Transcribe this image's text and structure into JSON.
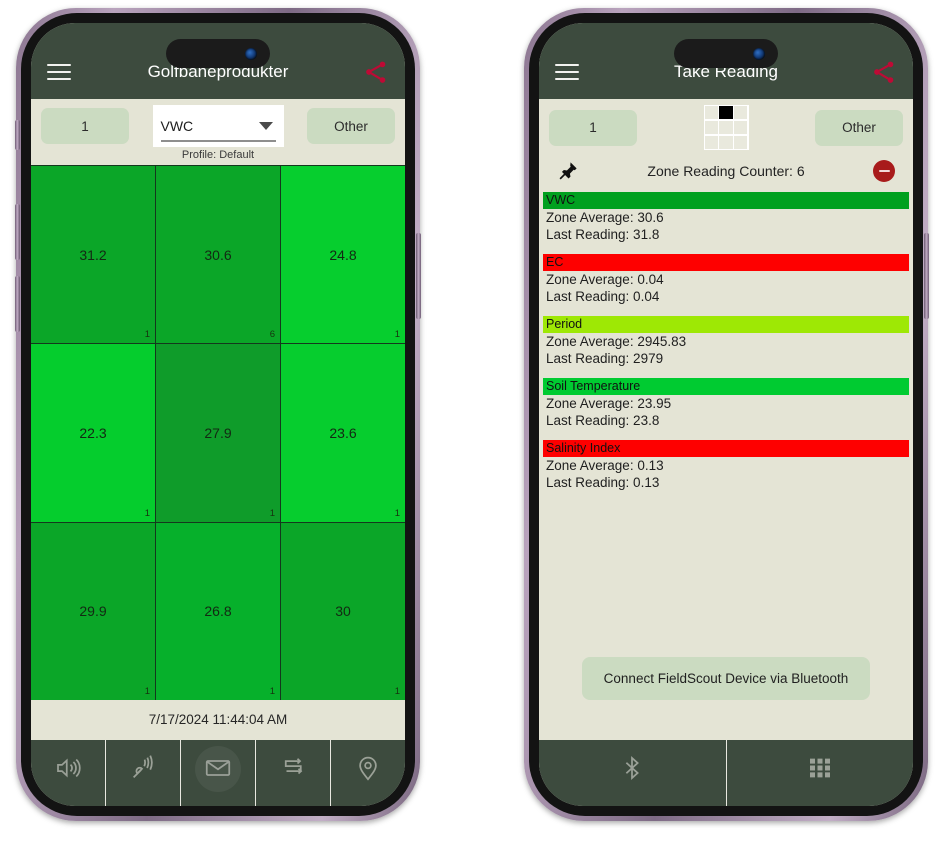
{
  "colors": {
    "appbar": "#3d4b3e",
    "background": "#e4e4d5",
    "pill": "#cbdbc1",
    "share_accent": "#be0a35",
    "minus_accent": "#a81b1b",
    "grid_border": "#14381d"
  },
  "left_phone": {
    "appbar": {
      "menu_icon": "hamburger-icon",
      "title": "Golfbaneprodukter",
      "share_icon": "share-icon"
    },
    "controls": {
      "zone_button": "1",
      "dropdown_value": "VWC",
      "dropdown_icon": "chevron-down-icon",
      "other_button": "Other",
      "profile_label": "Profile: Default"
    },
    "zone_grid": {
      "rows": 3,
      "cols": 3,
      "cells": [
        {
          "value": "31.2",
          "count": "1",
          "color": "#0ba628"
        },
        {
          "value": "30.6",
          "count": "6",
          "color": "#0ba628"
        },
        {
          "value": "24.8",
          "count": "1",
          "color": "#06ce2e"
        },
        {
          "value": "22.3",
          "count": "1",
          "color": "#05cd2d"
        },
        {
          "value": "27.9",
          "count": "1",
          "color": "#0f9c2a"
        },
        {
          "value": "23.6",
          "count": "1",
          "color": "#06cd2e"
        },
        {
          "value": "29.9",
          "count": "1",
          "color": "#0ba628"
        },
        {
          "value": "26.8",
          "count": "1",
          "color": "#06b02b"
        },
        {
          "value": "30",
          "count": "1",
          "color": "#0ba628"
        }
      ]
    },
    "timestamp": "7/17/2024 11:44:04 AM",
    "tabs": [
      {
        "icon": "speaker-icon"
      },
      {
        "icon": "satellite-dish-icon"
      },
      {
        "icon": "envelope-icon"
      },
      {
        "icon": "transfer-arrows-icon"
      },
      {
        "icon": "location-pin-icon"
      }
    ]
  },
  "right_phone": {
    "appbar": {
      "menu_icon": "hamburger-icon",
      "title": "Take Reading",
      "share_icon": "share-icon"
    },
    "controls": {
      "zone_button": "1",
      "other_button": "Other",
      "grid_selector": {
        "rows": 3,
        "cols": 3,
        "selected_index": 1
      }
    },
    "counter": {
      "pin_icon": "pushpin-icon",
      "label": "Zone Reading Counter: 6",
      "minus_icon": "minus-circle-icon"
    },
    "readings": [
      {
        "name": "VWC",
        "color": "#00a01f",
        "zone_average": "Zone Average: 30.6",
        "last_reading": "Last Reading: 31.8"
      },
      {
        "name": "EC",
        "color": "#fe0000",
        "zone_average": "Zone Average: 0.04",
        "last_reading": "Last Reading: 0.04"
      },
      {
        "name": "Period",
        "color": "#9ee805",
        "zone_average": "Zone Average: 2945.83",
        "last_reading": "Last Reading: 2979"
      },
      {
        "name": "Soil Temperature",
        "color": "#00cb31",
        "zone_average": "Zone Average: 23.95",
        "last_reading": "Last Reading: 23.8"
      },
      {
        "name": "Salinity Index",
        "color": "#fe0000",
        "zone_average": "Zone Average: 0.13",
        "last_reading": "Last Reading: 0.13"
      }
    ],
    "connect_button": "Connect FieldScout Device via Bluetooth",
    "tabs": [
      {
        "icon": "bluetooth-icon"
      },
      {
        "icon": "grid-icon"
      }
    ]
  }
}
